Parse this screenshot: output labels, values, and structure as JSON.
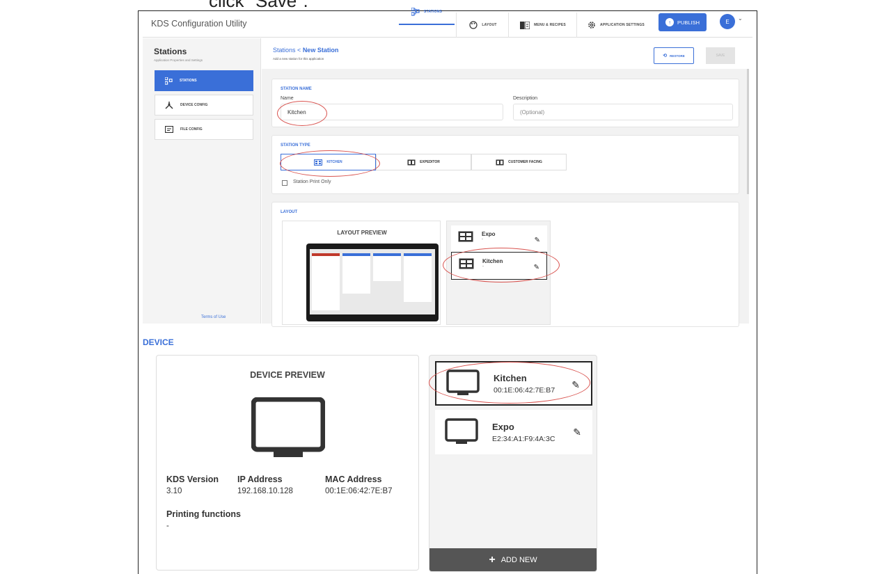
{
  "caption": "click \"Save\".",
  "header": {
    "app_title": "KDS Configuration Utility",
    "nav": [
      {
        "label": "STATIONS"
      },
      {
        "label": "LAYOUT"
      },
      {
        "label": "MENU & RECIPES"
      },
      {
        "label": "APPLICATION SETTINGS"
      }
    ],
    "publish_label": "PUBLISH",
    "avatar_initial": "E"
  },
  "sidebar": {
    "title": "Stations",
    "subtitle": "Application Properties and Settings",
    "items": [
      {
        "label": "STATIONS",
        "active": true
      },
      {
        "label": "DEVICE CONFIG",
        "active": false
      },
      {
        "label": "FILE CONFIG",
        "active": false
      }
    ],
    "terms_label": "Terms of Use"
  },
  "main": {
    "breadcrumb_parent": "Stations",
    "breadcrumb_current": "New Station",
    "subtitle": "Add a new station for this application",
    "restore_label": "RESTORE",
    "save_label": "SAVE",
    "station_name": {
      "section_label": "STATION NAME",
      "name_label": "Name",
      "name_value": "Kitchen",
      "description_label": "Description",
      "description_placeholder": "(Optional)"
    },
    "station_type": {
      "section_label": "STATION TYPE",
      "options": [
        {
          "label": "KITCHEN",
          "active": true
        },
        {
          "label": "EXPEDITOR",
          "active": false
        },
        {
          "label": "CUSTOMER FACING",
          "active": false
        }
      ],
      "print_only_label": "Station Print Only"
    },
    "layout": {
      "section_label": "LAYOUT",
      "preview_title": "LAYOUT PREVIEW",
      "items": [
        {
          "name": "Expo",
          "sub": "-"
        },
        {
          "name": "Kitchen",
          "sub": "-"
        }
      ]
    }
  },
  "device": {
    "section_label": "DEVICE",
    "preview_title": "DEVICE PREVIEW",
    "kds_version_label": "KDS Version",
    "kds_version": "3.10",
    "ip_label": "IP Address",
    "ip_value": "192.168.10.128",
    "mac_label": "MAC Address",
    "mac_value": "00:1E:06:42:7E:B7",
    "printing_label": "Printing functions",
    "printing_value": "-",
    "items": [
      {
        "name": "Kitchen",
        "mac": "00:1E:06:42:7E:B7"
      },
      {
        "name": "Expo",
        "mac": "E2:34:A1:F9:4A:3C"
      }
    ],
    "add_new_label": "ADD NEW"
  },
  "colors": {
    "accent": "#3a6fd8",
    "annotation": "#d9534f"
  }
}
